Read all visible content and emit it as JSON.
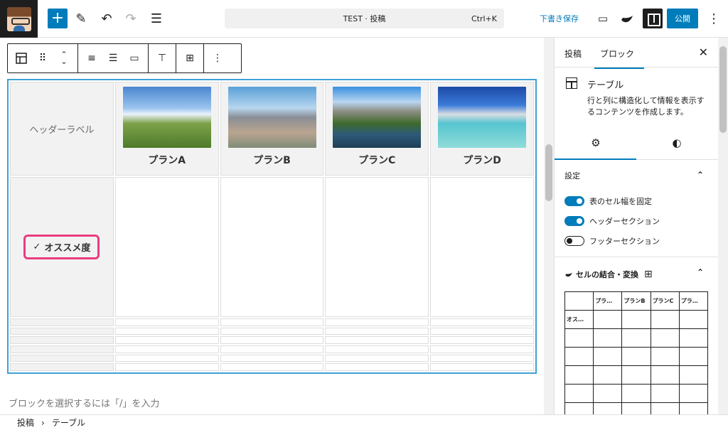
{
  "topbar": {
    "document_title": "TEST · 投稿",
    "shortcut": "Ctrl+K",
    "save_draft": "下書き保存",
    "publish": "公開",
    "icons": [
      "add-icon",
      "pen-icon",
      "undo-icon",
      "redo-icon",
      "list-view-icon",
      "desktop-preview-icon",
      "block-theme-icon",
      "settings-panel-icon",
      "more-vertical-icon"
    ]
  },
  "editor": {
    "table": {
      "corner_label": "ヘッダーラベル",
      "plans": [
        {
          "label": "プランA",
          "image": "mountain-meadow"
        },
        {
          "label": "プランB",
          "image": "city-skyline"
        },
        {
          "label": "プランC",
          "image": "river-valley"
        },
        {
          "label": "プランD",
          "image": "tropical-beach"
        }
      ],
      "row_label": "オススメ度",
      "row_check": "✓"
    },
    "appender_text": "ブロックを選択するには「/」を入力"
  },
  "sidebar": {
    "tabs": [
      "投稿",
      "ブロック"
    ],
    "active_tab": "ブロック",
    "close": "✕",
    "block_name": "テーブル",
    "block_description": "行と列に構造化して情報を表示するコンテンツを作成します。",
    "settings_title": "設定",
    "toggles": [
      {
        "label": "表のセル幅を固定",
        "on": true
      },
      {
        "label": "ヘッダーセクション",
        "on": true
      },
      {
        "label": "フッターセクション",
        "on": false
      }
    ],
    "merge_title": "セルの結合・変換",
    "mini_headers": [
      "",
      "プラ…",
      "プランB",
      "プランC",
      "プラ…"
    ],
    "mini_row_label": "オス…"
  },
  "breadcrumb": {
    "root": "投稿",
    "separator": "›",
    "current": "テーブル"
  }
}
